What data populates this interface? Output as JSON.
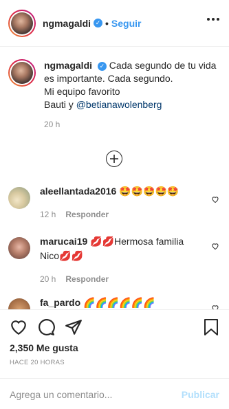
{
  "header": {
    "username": "ngmagaldi",
    "verified_icon": "verified-badge-icon",
    "separator": "•",
    "follow_label": "Seguir",
    "more_icon": "more-options-icon"
  },
  "caption": {
    "username": "ngmagaldi",
    "line1": "Cada segundo de tu vida es importante. Cada segundo.",
    "line2": "Mi equipo favorito",
    "line3_prefix": "Bauti y ",
    "mention": "@betianawolenberg",
    "time": "20 h"
  },
  "load_more_icon": "plus-circle-icon",
  "comments": [
    {
      "username": "aleellantada2016",
      "text": "🤩🤩🤩🤩🤩",
      "time": "12 h",
      "reply_label": "Responder"
    },
    {
      "username": "marucai19",
      "text": "💋💋Hermosa familia Nico💋💋",
      "time": "20 h",
      "reply_label": "Responder"
    },
    {
      "username": "fa_pardo",
      "text": "🌈🌈🌈🌈🌈🌈",
      "time": "",
      "reply_label": ""
    }
  ],
  "actions": {
    "likes": "2,350 Me gusta",
    "post_time": "HACE 20 HORAS"
  },
  "add_comment": {
    "placeholder": "Agrega un comentario...",
    "publish_label": "Publicar"
  },
  "colors": {
    "accent": "#3897f0",
    "mention": "#00376b",
    "muted": "#8e8e8e",
    "publish_disabled": "#b2dffc"
  }
}
